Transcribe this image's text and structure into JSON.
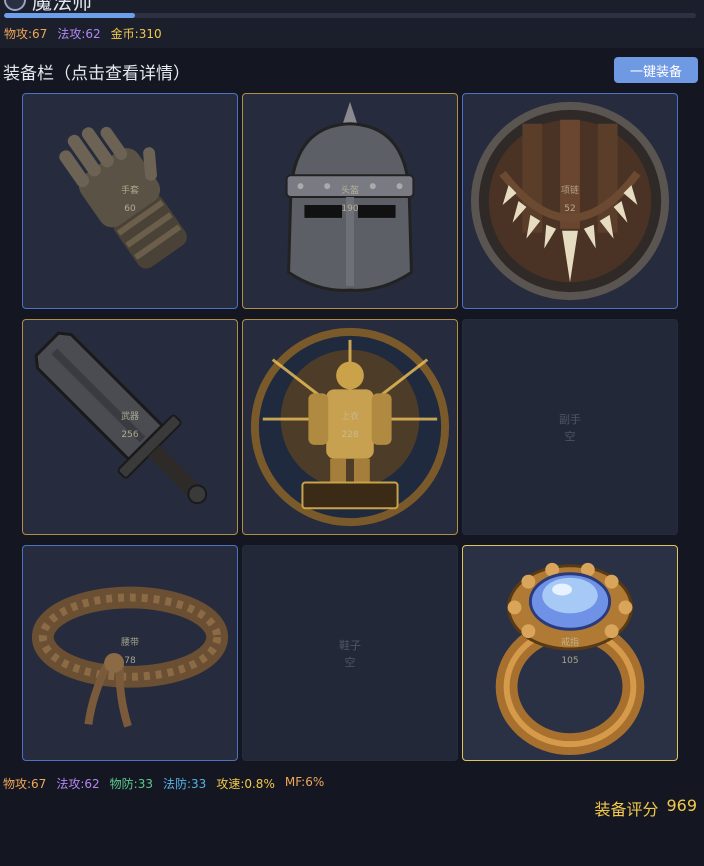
{
  "header": {
    "char_name": "魔法师",
    "xp_progress": 0.19,
    "stats": {
      "atk": "物攻:67",
      "mag": "法攻:62",
      "gold": "金币:310"
    }
  },
  "equip_panel": {
    "title": "装备栏（点击查看详情）",
    "equip_all_button": "一键装备",
    "slots": [
      {
        "label": "手套",
        "value": "60",
        "icon": "gauntlet-icon",
        "state": "equipped"
      },
      {
        "label": "头盔",
        "value": "190",
        "icon": "helmet-icon",
        "state": "equipped"
      },
      {
        "label": "项链",
        "value": "52",
        "icon": "necklace-icon",
        "state": "equipped"
      },
      {
        "label": "武器",
        "value": "256",
        "icon": "sword-icon",
        "state": "equipped"
      },
      {
        "label": "上衣",
        "value": "228",
        "icon": "armor-icon",
        "state": "equipped"
      },
      {
        "label": "副手",
        "value": "空",
        "icon": "",
        "state": "empty"
      },
      {
        "label": "腰带",
        "value": "78",
        "icon": "belt-icon",
        "state": "equipped"
      },
      {
        "label": "鞋子",
        "value": "空",
        "icon": "",
        "state": "empty"
      },
      {
        "label": "戒指",
        "value": "105",
        "icon": "ring-icon",
        "state": "equipped"
      }
    ]
  },
  "summary": {
    "stats": {
      "atk": "物攻:67",
      "mag": "法攻:62",
      "pdef": "物防:33",
      "mdef": "法防:33",
      "speed": "攻速:0.8%",
      "mf": "MF:6%"
    },
    "rating_label": "装备评分",
    "rating_value": "969"
  },
  "colors": {
    "background": "#141722",
    "accent_button": "#6f99e2",
    "rating_gold": "#f2c84b",
    "rare_border": "#4b72c2",
    "epic_border": "#b08e45",
    "legend_border": "#e0c65a"
  }
}
